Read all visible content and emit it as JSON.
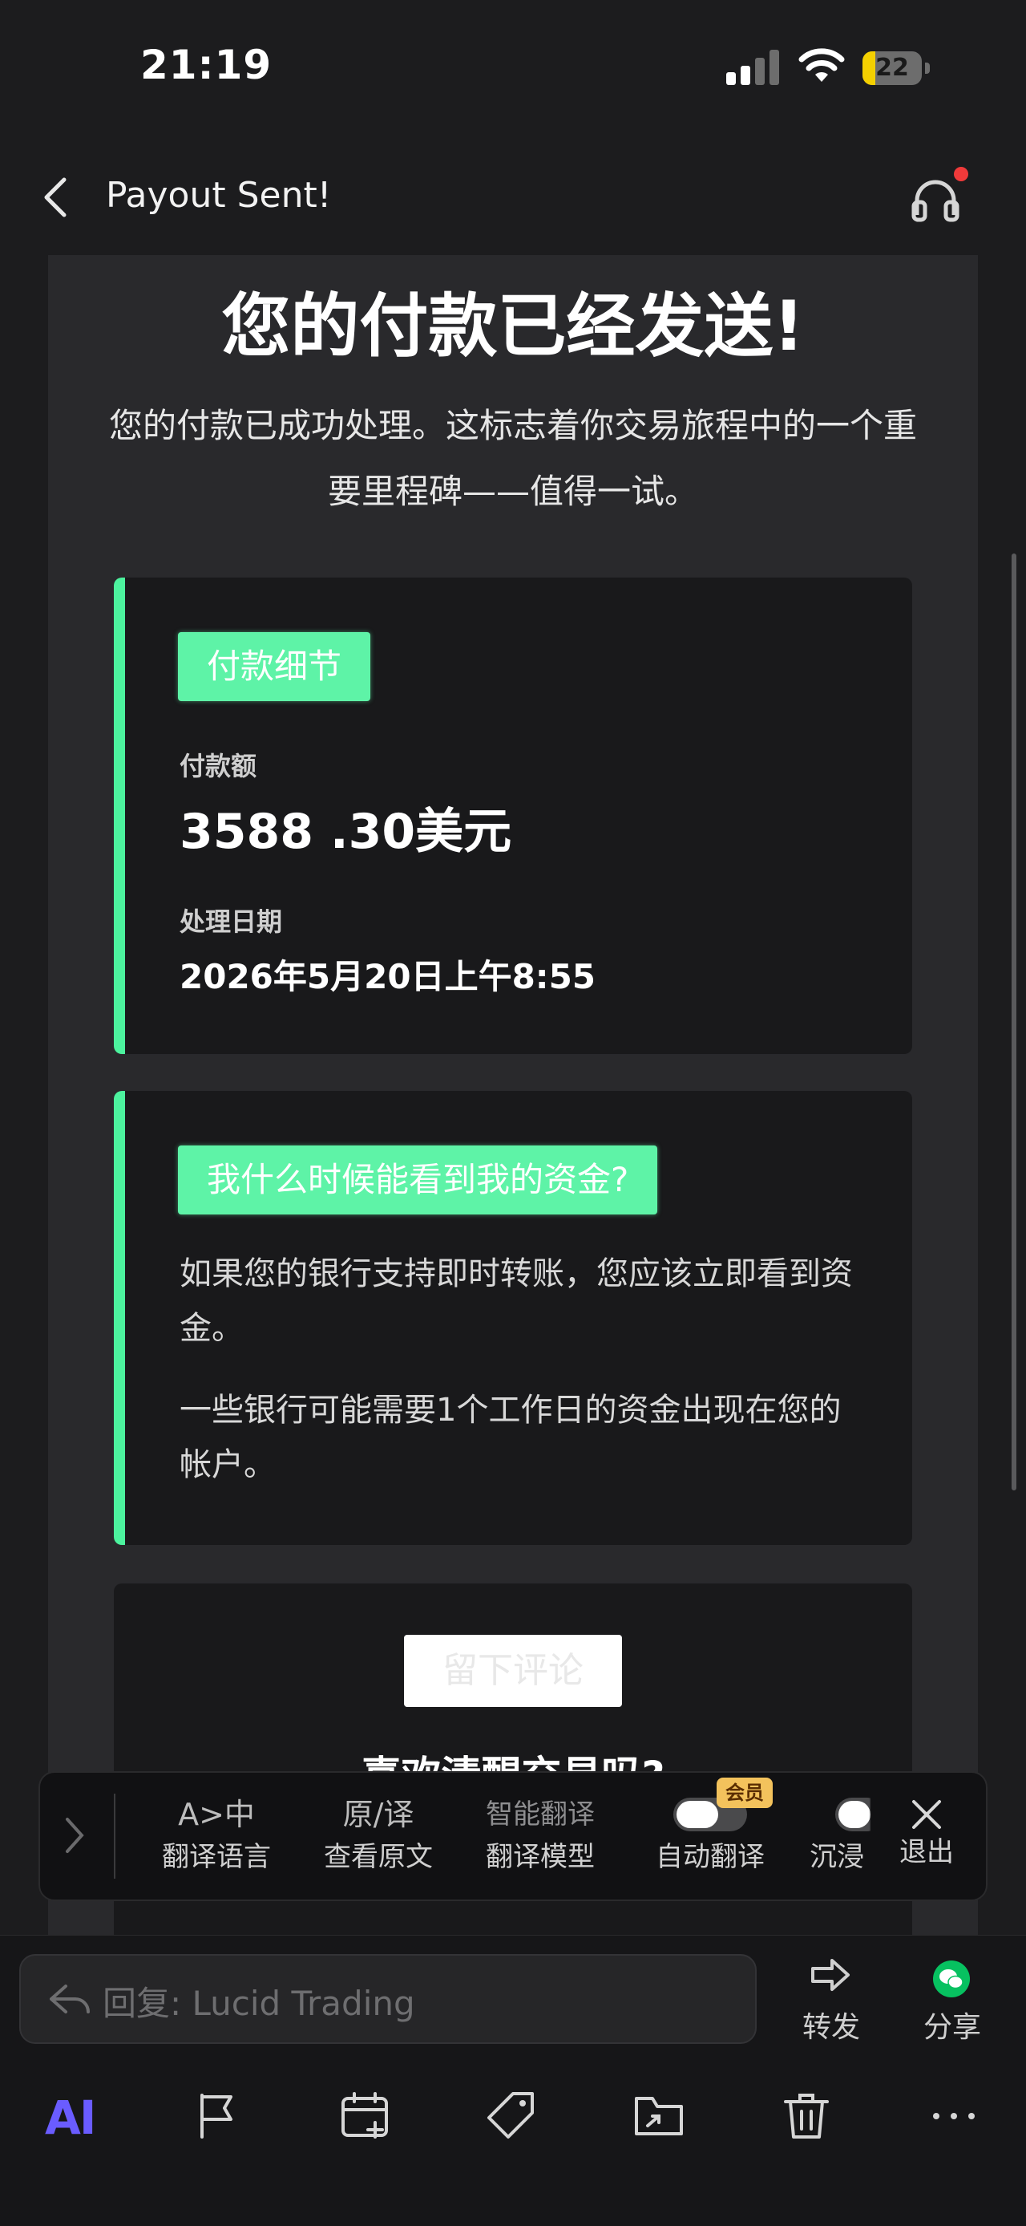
{
  "status_bar": {
    "time": "21:19",
    "battery_level": "22",
    "battery_fraction": 0.22
  },
  "nav": {
    "title": "Payout Sent!"
  },
  "email": {
    "headline": "您的付款已经发送!",
    "intro": "您的付款已成功处理。这标志着你交易旅程中的一个重要里程碑——值得一试。",
    "details_card": {
      "badge": "付款细节",
      "amount_label": "付款额",
      "amount_value": "3588 .30美元",
      "date_label": "处理日期",
      "date_value": "2026年5月20日上午8:55"
    },
    "funds_card": {
      "badge": "我什么时候能看到我的资金?",
      "para1": "如果您的银行支持即时转账，您应该立即看到资金。",
      "para2": "一些银行可能需要1个工作日的资金出现在您的帐户。"
    },
    "cta_button": "留下评论",
    "promo_title": "喜欢清醒交易吗?"
  },
  "translate_toolbar": {
    "vip_badge": "会员",
    "items": [
      {
        "top": "A>中",
        "bottom": "翻译语言"
      },
      {
        "top": "原/译",
        "bottom": "查看原文"
      },
      {
        "top": "智能翻译",
        "bottom": "翻译模型"
      },
      {
        "top": "",
        "bottom": "自动翻译"
      },
      {
        "top": "",
        "bottom": "沉浸"
      },
      {
        "top": "",
        "bottom": "退出"
      }
    ]
  },
  "reply": {
    "placeholder": "回复: Lucid Trading",
    "forward_label": "转发",
    "share_label": "分享"
  },
  "bottom_toolbar": {
    "ai_label": "AI"
  },
  "colors": {
    "accent_green": "#4cf29e",
    "ai_purple": "#6a5cff",
    "background": "#1c1c1e",
    "notification_red": "#f03a3a"
  },
  "icons": [
    "back-chevron-icon",
    "headset-icon",
    "forward-icon",
    "wechat-icon",
    "flag-icon",
    "calendar-add-icon",
    "tag-icon",
    "move-folder-icon",
    "trash-icon",
    "more-icon",
    "close-icon",
    "reply-icon"
  ]
}
